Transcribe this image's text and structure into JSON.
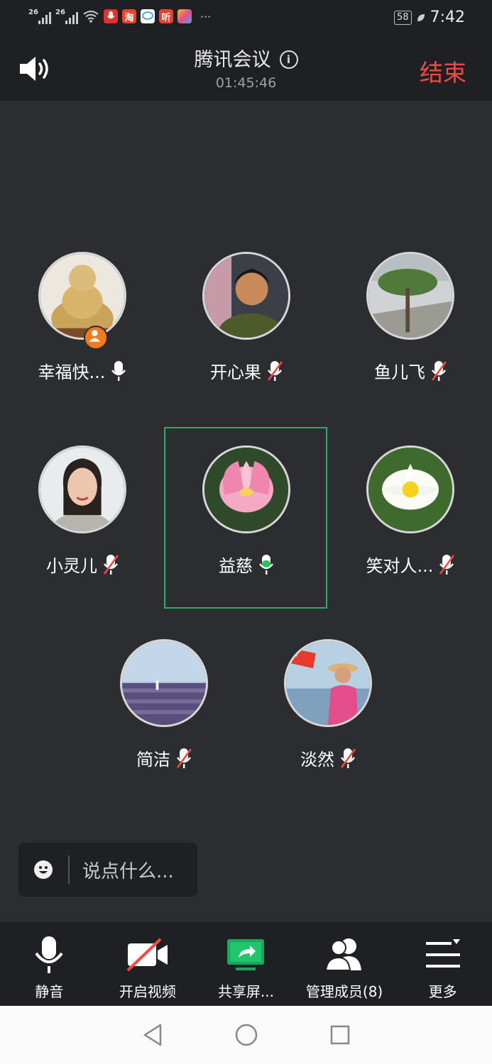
{
  "status_bar": {
    "signal1": "26",
    "signal2": "26",
    "app_taobao": "淘",
    "app_ting": "听",
    "more": "···",
    "battery": "58",
    "time": "7:42"
  },
  "header": {
    "title": "腾讯会议",
    "timer": "01:45:46",
    "end_label": "结束",
    "icons": [
      "speaker-icon",
      "info-icon"
    ]
  },
  "participants": [
    {
      "name": "幸福快...",
      "mic": "on",
      "host": true
    },
    {
      "name": "开心果",
      "mic": "muted"
    },
    {
      "name": "鱼儿飞",
      "mic": "muted"
    },
    {
      "name": "小灵儿",
      "mic": "muted"
    },
    {
      "name": "益慈",
      "mic": "speaking",
      "active": true
    },
    {
      "name": "笑对人...",
      "mic": "muted"
    },
    {
      "name": "简洁",
      "mic": "muted"
    },
    {
      "name": "淡然",
      "mic": "muted"
    }
  ],
  "chat": {
    "placeholder": "说点什么..."
  },
  "toolbar": {
    "mute": "静音",
    "video": "开启视频",
    "share": "共享屏...",
    "members": "管理成员(8)",
    "more": "更多"
  },
  "colors": {
    "background": "#2b2d31",
    "bar": "#1f2023",
    "end_red": "#f04a42",
    "active_green": "#20b060",
    "host_orange": "#f07a1c"
  }
}
